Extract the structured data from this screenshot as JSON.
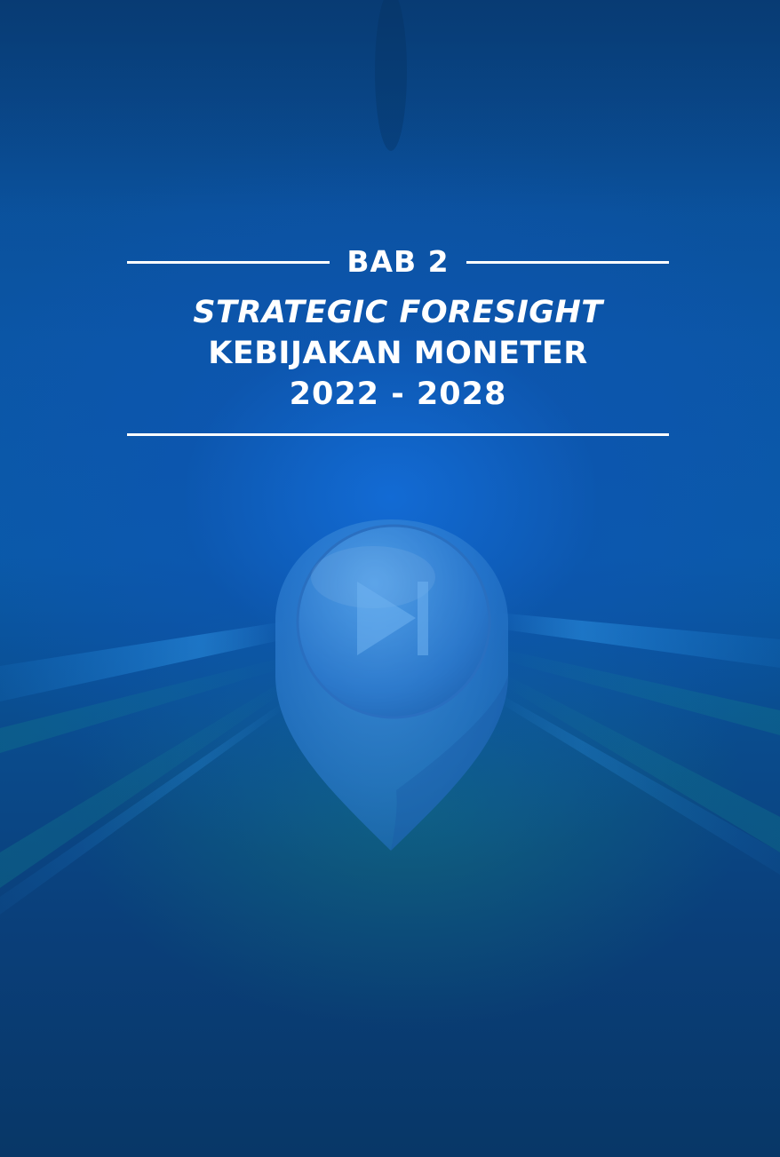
{
  "cover": {
    "chapter_label": "BAB 2",
    "title_italic": "STRATEGIC FORESIGHT",
    "title_main": "KEBIJAKAN MONETER",
    "period": "2022 - 2028",
    "icon": "location-pin-skip-forward-icon",
    "colors": {
      "background_primary": "#0a56a6",
      "background_dark": "#083767",
      "text": "#ffffff"
    }
  }
}
